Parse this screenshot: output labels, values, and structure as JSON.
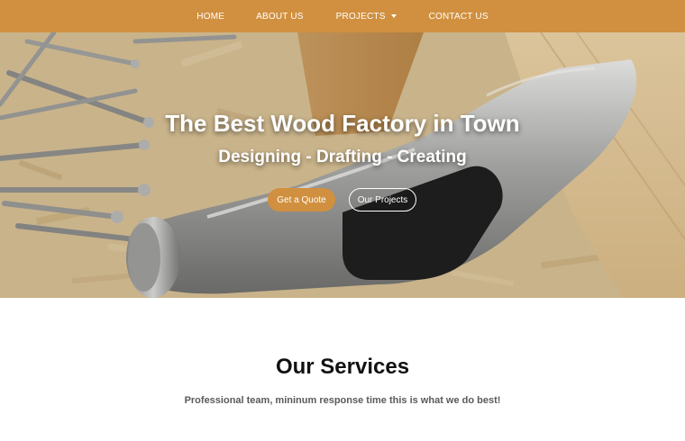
{
  "nav": {
    "items": [
      {
        "label": "HOME"
      },
      {
        "label": "ABOUT US"
      },
      {
        "label": "PROJECTS"
      },
      {
        "label": "CONTACT US"
      }
    ],
    "background": "#d1903f"
  },
  "hero": {
    "title": "The Best Wood Factory in Town",
    "subtitle": "Designing - Drafting - Creating",
    "primary_button": "Get a Quote",
    "secondary_button": "Our Projects",
    "accent": "#d1903f"
  },
  "services": {
    "title": "Our Services",
    "subtitle": "Professional team, mininum response time this is what we do best!"
  }
}
